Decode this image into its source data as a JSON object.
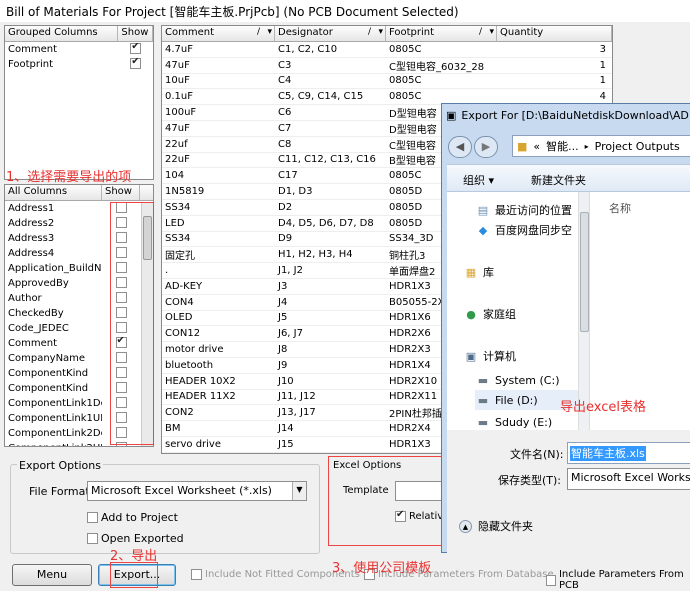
{
  "title": "Bill of Materials For Project [智能车主板.PrjPcb] (No PCB Document Selected)",
  "grouped": {
    "headers": [
      "Grouped Columns",
      "Show"
    ],
    "rows": [
      {
        "name": "Comment",
        "show": true
      },
      {
        "name": "Footprint",
        "show": true
      }
    ]
  },
  "all_columns": {
    "headers": [
      "All Columns",
      "Show"
    ],
    "rows": [
      {
        "name": "Address1",
        "show": false
      },
      {
        "name": "Address2",
        "show": false
      },
      {
        "name": "Address3",
        "show": false
      },
      {
        "name": "Address4",
        "show": false
      },
      {
        "name": "Application_BuildNur",
        "show": false
      },
      {
        "name": "ApprovedBy",
        "show": false
      },
      {
        "name": "Author",
        "show": false
      },
      {
        "name": "CheckedBy",
        "show": false
      },
      {
        "name": "Code_JEDEC",
        "show": false
      },
      {
        "name": "Comment",
        "show": true
      },
      {
        "name": "CompanyName",
        "show": false
      },
      {
        "name": "ComponentKind",
        "show": false
      },
      {
        "name": "ComponentKind",
        "show": false
      },
      {
        "name": "ComponentLink1Des",
        "show": false
      },
      {
        "name": "ComponentLink1URI",
        "show": false
      },
      {
        "name": "ComponentLink2Des",
        "show": false
      },
      {
        "name": "ComponentLink2URI",
        "show": false
      }
    ]
  },
  "bom": {
    "headers": [
      "Comment",
      "Designator",
      "Footprint",
      "Quantity"
    ],
    "rows": [
      [
        "4.7uF",
        "C1, C2, C10",
        "0805C",
        "3"
      ],
      [
        "47uF",
        "C3",
        "C型钽电容_6032_28",
        "1"
      ],
      [
        "10uF",
        "C4",
        "0805C",
        "1"
      ],
      [
        "0.1uF",
        "C5, C9, C14, C15",
        "0805C",
        "4"
      ],
      [
        "100uF",
        "C6",
        "D型钽电容",
        ""
      ],
      [
        "47uF",
        "C7",
        "D型钽电容",
        ""
      ],
      [
        "22uf",
        "C8",
        "C型钽电容",
        ""
      ],
      [
        "22uF",
        "C11, C12, C13, C16",
        "B型钽电容",
        ""
      ],
      [
        "104",
        "C17",
        "0805C",
        ""
      ],
      [
        "1N5819",
        "D1, D3",
        "0805D",
        ""
      ],
      [
        "SS34",
        "D2",
        "0805D",
        ""
      ],
      [
        "LED",
        "D4, D5, D6, D7, D8",
        "0805D",
        ""
      ],
      [
        "SS34",
        "D9",
        "SS34_3D",
        ""
      ],
      [
        "固定孔",
        "H1, H2, H3, H4",
        "铜柱孔3",
        ""
      ],
      [
        ".",
        "J1, J2",
        "单面焊盘2",
        ""
      ],
      [
        "AD-KEY",
        "J3",
        "HDR1X3",
        ""
      ],
      [
        "CON4",
        "J4",
        "B05055-2X",
        ""
      ],
      [
        "OLED",
        "J5",
        "HDR1X6",
        ""
      ],
      [
        "CON12",
        "J6, J7",
        "HDR2X6",
        ""
      ],
      [
        "motor drive",
        "J8",
        "HDR2X3",
        ""
      ],
      [
        "bluetooth",
        "J9",
        "HDR1X4",
        ""
      ],
      [
        "HEADER 10X2",
        "J10",
        "HDR2X10",
        ""
      ],
      [
        "HEADER 11X2",
        "J11, J12",
        "HDR2X11",
        ""
      ],
      [
        "CON2",
        "J13, J17",
        "2PIN杜邦插",
        ""
      ],
      [
        "BM",
        "J14",
        "HDR2X4",
        ""
      ],
      [
        "servo drive",
        "J15",
        "HDR1X3",
        ""
      ]
    ]
  },
  "export_options": {
    "legend": "Export Options",
    "file_format_label": "File Format",
    "file_format_value": "Microsoft Excel Worksheet (*.xls)",
    "add_to_project": "Add to Project",
    "open_exported": "Open Exported"
  },
  "excel_options": {
    "legend": "Excel Options",
    "template_label": "Template",
    "relative": "Relativ"
  },
  "buttons": {
    "menu": "Menu",
    "export": "Export..."
  },
  "bottom_checks": {
    "not_fitted": "Include Not Fitted Components",
    "db_params": "Include Parameters From Database",
    "pcb_params": "Include Parameters From PCB"
  },
  "annotations": {
    "step1": "1、选择需要导出的项",
    "step2": "2、导出",
    "step3": "3、使用公司模板",
    "excel": "导出excel表格"
  },
  "dialog": {
    "title": "Export For [D:\\BaiduNetdiskDownload\\AD",
    "breadcrumb": [
      "«",
      "智能...",
      "▸",
      "Project Outputs"
    ],
    "organize": "组织 ▾",
    "new_folder": "新建文件夹",
    "column_name": "名称",
    "nav": [
      {
        "icon": "recent-icon",
        "label": "最近访问的位置"
      },
      {
        "icon": "baidu-icon",
        "label": "百度网盘同步空"
      },
      {
        "icon": "library-icon",
        "label": "库"
      },
      {
        "icon": "homegroup-icon",
        "label": "家庭组"
      },
      {
        "icon": "computer-icon",
        "label": "计算机"
      },
      {
        "icon": "drive-icon",
        "label": "System (C:)"
      },
      {
        "icon": "drive-icon",
        "label": "File (D:)"
      },
      {
        "icon": "drive-icon",
        "label": "Sdudy (E:)"
      }
    ],
    "filename_label": "文件名(N):",
    "filename_value": "智能车主板.xls",
    "filetype_label": "保存类型(T):",
    "filetype_value": "Microsoft Excel Works",
    "hide_folders": "隐藏文件夹"
  }
}
